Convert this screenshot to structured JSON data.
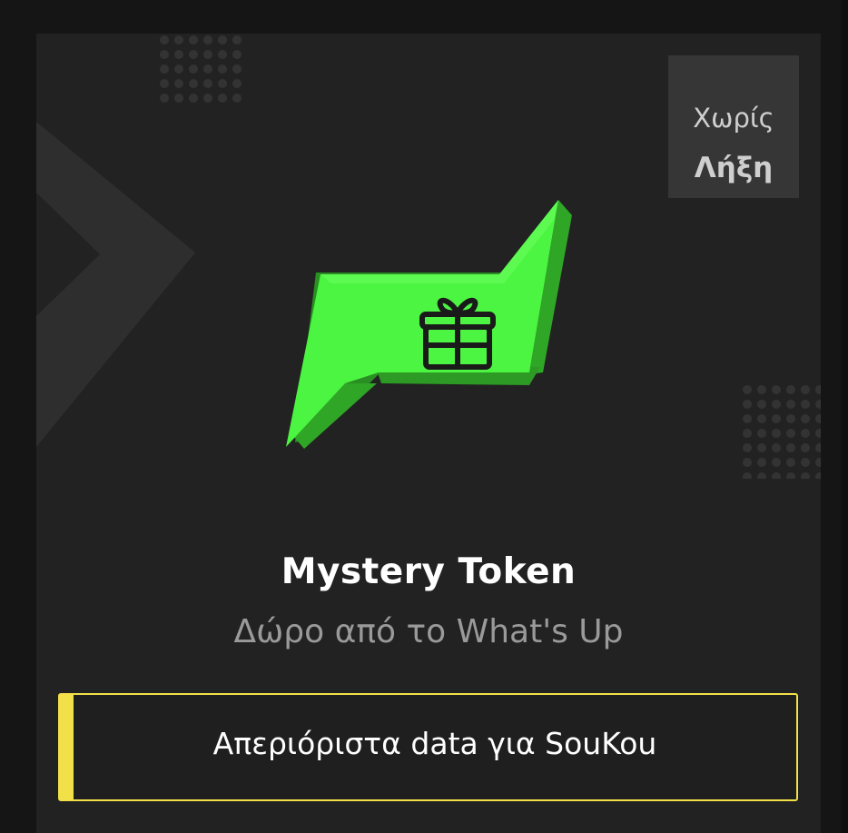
{
  "badge": {
    "line1": "Χωρίς",
    "line2": "Λήξη"
  },
  "token": {
    "name": "Mystery Token",
    "subtitle": "Δώρο από το What's Up",
    "icon": "gift-icon",
    "accent_color": "#4cf542"
  },
  "benefit": {
    "label": "Απεριόριστα data για SouKou",
    "accent_color": "#f2e048"
  }
}
